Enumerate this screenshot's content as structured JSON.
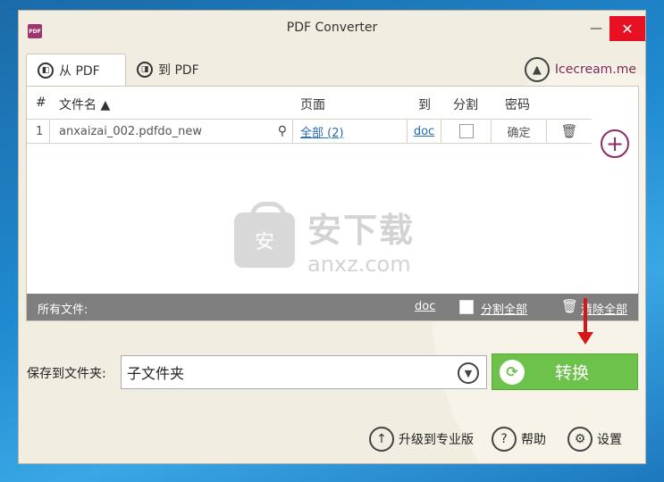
{
  "window": {
    "title": "PDF Converter",
    "minimize_glyph": "—",
    "close_glyph": "✕",
    "app_icon_text": "PDF"
  },
  "tabs": [
    {
      "label": "从 PDF",
      "icon": "pdf-out-icon"
    },
    {
      "label": "到 PDF",
      "icon": "pdf-in-icon"
    }
  ],
  "brand": {
    "label": "Icecream.me",
    "icon": "icecream-icon"
  },
  "table": {
    "headers": {
      "index": "#",
      "filename": "文件名 ▲",
      "pages": "页面",
      "to": "到",
      "split": "分割",
      "password": "密码"
    },
    "rows": [
      {
        "index": "1",
        "filename": "anxaizai_002.pdfdo_new",
        "pages": "全部 (2)",
        "to": "doc",
        "split": false,
        "password": "确定"
      }
    ]
  },
  "watermark": {
    "cn": "安下载",
    "en": "anxz.com",
    "bag_char": "安"
  },
  "footer": {
    "all_files": "所有文件:",
    "format": "doc",
    "split_all": "分割全部",
    "clear_all": "清除全部"
  },
  "save": {
    "label": "保存到文件夹:",
    "value": "子文件夹"
  },
  "convert": {
    "label": "转换"
  },
  "bottom": {
    "upgrade": "升级到专业版",
    "help": "帮助",
    "settings": "设置"
  },
  "colors": {
    "accent": "#8d2b63",
    "convert": "#6cc24a",
    "close": "#e81123",
    "link": "#1f6ab3"
  }
}
